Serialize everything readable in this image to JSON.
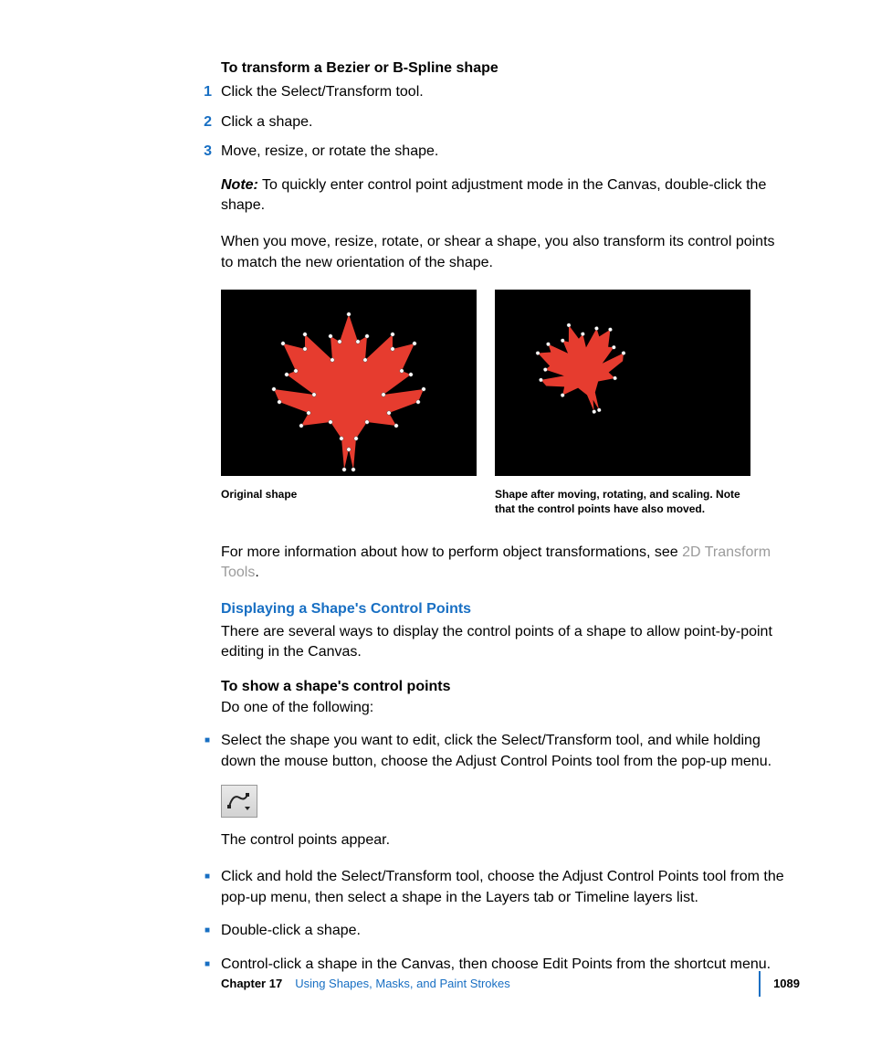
{
  "headings": {
    "transform": "To transform a Bezier or B-Spline shape",
    "display": "Displaying a Shape's Control Points",
    "show": "To show a shape's control points"
  },
  "steps": [
    "Click the Select/Transform tool.",
    "Click a shape.",
    "Move, resize, or rotate the shape."
  ],
  "note": {
    "label": "Note:",
    "text": "To quickly enter control point adjustment mode in the Canvas, double-click the shape."
  },
  "para_transform": "When you move, resize, rotate, or shear a shape, you also transform its control points to match the new orientation of the shape.",
  "captions": {
    "left": "Original shape",
    "right": "Shape after moving, rotating, and scaling. Note that the control points have also moved."
  },
  "more_info": {
    "pre": "For more information about how to perform object transformations, see ",
    "link": "2D Transform Tools",
    "post": "."
  },
  "display_intro": "There are several ways to display the control points of a shape to allow point-by-point editing in the Canvas.",
  "do_following": "Do one of the following:",
  "bullets_first": "Select the shape you want to edit, click the Select/Transform tool, and while holding down the mouse button, choose the Adjust Control Points tool from the pop-up menu.",
  "control_points_appear": "The control points appear.",
  "bullets_rest": [
    "Click and hold the Select/Transform tool, choose the Adjust Control Points tool from the pop-up menu, then select a shape in the Layers tab or Timeline layers list.",
    "Double-click a shape.",
    "Control-click a shape in the Canvas, then choose Edit Points from the shortcut menu."
  ],
  "footer": {
    "chapter_label": "Chapter 17",
    "chapter_title": "Using Shapes, Masks, and Paint Strokes",
    "page": "1089"
  }
}
